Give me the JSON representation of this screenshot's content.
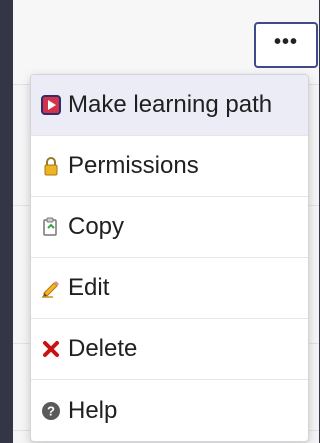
{
  "toolbar": {
    "more_label": "•••"
  },
  "menu": {
    "items": [
      {
        "label": "Make learning path",
        "icon": "learning-path-icon"
      },
      {
        "label": "Permissions",
        "icon": "lock-icon"
      },
      {
        "label": "Copy",
        "icon": "copy-icon"
      },
      {
        "label": "Edit",
        "icon": "pencil-icon"
      },
      {
        "label": "Delete",
        "icon": "x-icon"
      },
      {
        "label": "Help",
        "icon": "help-icon"
      }
    ]
  },
  "colors": {
    "background": "#343545",
    "button_border": "#3f4a8a",
    "active_item": "#ececf6",
    "delete_icon": "#cc1111"
  }
}
